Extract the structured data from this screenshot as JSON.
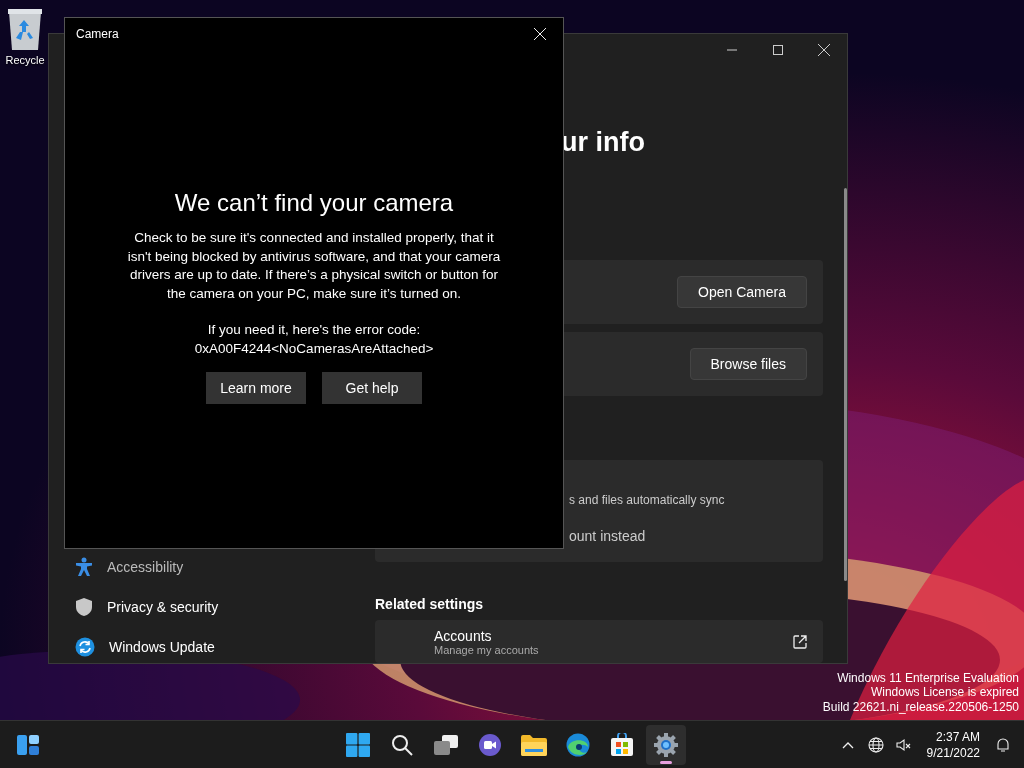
{
  "desktop": {
    "icons": [
      {
        "kind": "recycle-bin",
        "label": "Recycle"
      }
    ],
    "build_info": [
      "Windows 11 Enterprise Evaluation",
      "Windows License is expired",
      "Build 22621.ni_release.220506-1250"
    ]
  },
  "settings_window": {
    "heading": "ur info",
    "sidebar": {
      "items": [
        {
          "kind": "accessibility",
          "label": "Accessibility",
          "selected": false
        },
        {
          "kind": "privacy",
          "label": "Privacy & security",
          "selected": false
        },
        {
          "kind": "update",
          "label": "Windows Update",
          "selected": false
        }
      ]
    },
    "cards": [
      {
        "kind": "action",
        "button": "Open Camera"
      },
      {
        "kind": "action",
        "button": "Browse files"
      },
      {
        "kind": "info",
        "text": "s and files automatically sync",
        "link": "ount instead"
      }
    ],
    "related": {
      "title": "Related settings",
      "items": [
        {
          "title": "Accounts",
          "subtitle": "Manage my accounts"
        }
      ]
    }
  },
  "camera_window": {
    "title": "Camera",
    "heading": "We can’t find your camera",
    "message": "Check to be sure it's connected and installed properly, that it isn't being blocked by antivirus software, and that your camera drivers are up to date. If there’s a physical switch or button for the camera on your PC, make sure it’s turned on.",
    "error_lines": [
      "If you need it, here's the error code:",
      "0xA00F4244<NoCamerasAreAttached>"
    ],
    "buttons": [
      "Learn more",
      "Get help"
    ]
  },
  "taskbar": {
    "widgets": {
      "kind": "widgets"
    },
    "apps": [
      {
        "kind": "start",
        "active": false
      },
      {
        "kind": "search",
        "active": false
      },
      {
        "kind": "taskview",
        "active": false
      },
      {
        "kind": "chat",
        "active": false
      },
      {
        "kind": "explorer",
        "active": false
      },
      {
        "kind": "edge",
        "active": false
      },
      {
        "kind": "store",
        "active": false
      },
      {
        "kind": "settings",
        "active": true
      }
    ],
    "clock": {
      "time": "2:37 AM",
      "date": "9/21/2022"
    }
  }
}
